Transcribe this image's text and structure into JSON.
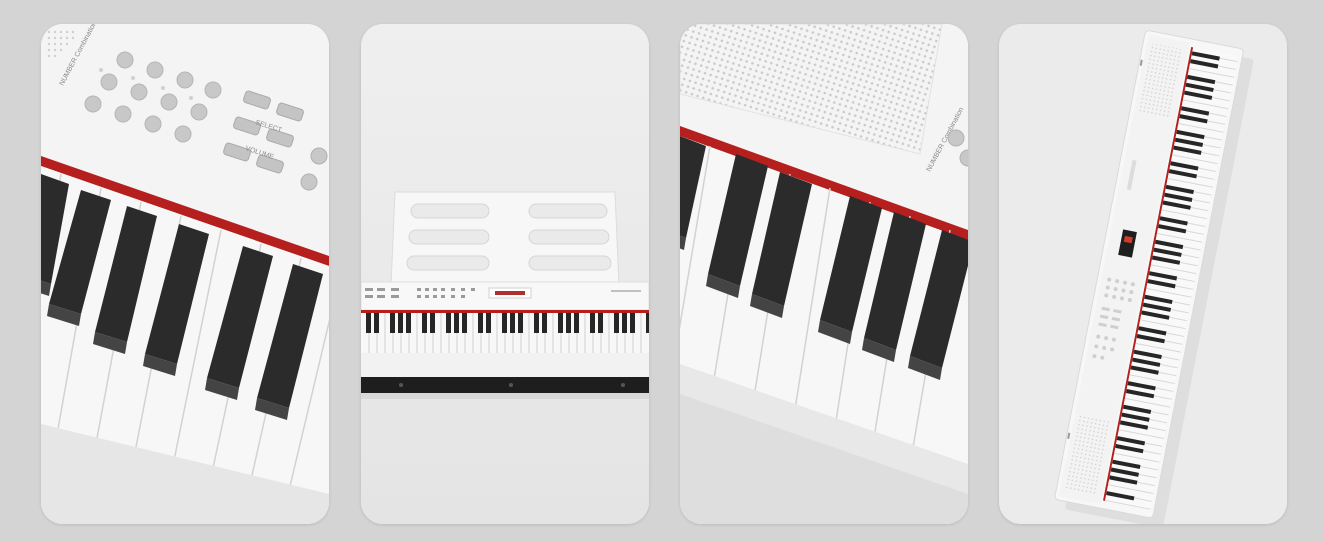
{
  "gallery": {
    "panels": [
      {
        "view": "control-panel-closeup",
        "labels": {
          "number_combination": "NUMBER Combination",
          "select": "SELECT",
          "volume": "VOLUME"
        }
      },
      {
        "view": "front-view-with-music-stand"
      },
      {
        "view": "speaker-grille-closeup",
        "labels": {
          "number_combination": "NUMBER Combination"
        }
      },
      {
        "view": "full-keyboard-top-view"
      }
    ],
    "colors": {
      "background": "#d4d4d4",
      "panel": "#ececec",
      "body_white": "#f7f7f7",
      "black_key": "#2b2b2b",
      "felt_red": "#b5201e"
    }
  }
}
